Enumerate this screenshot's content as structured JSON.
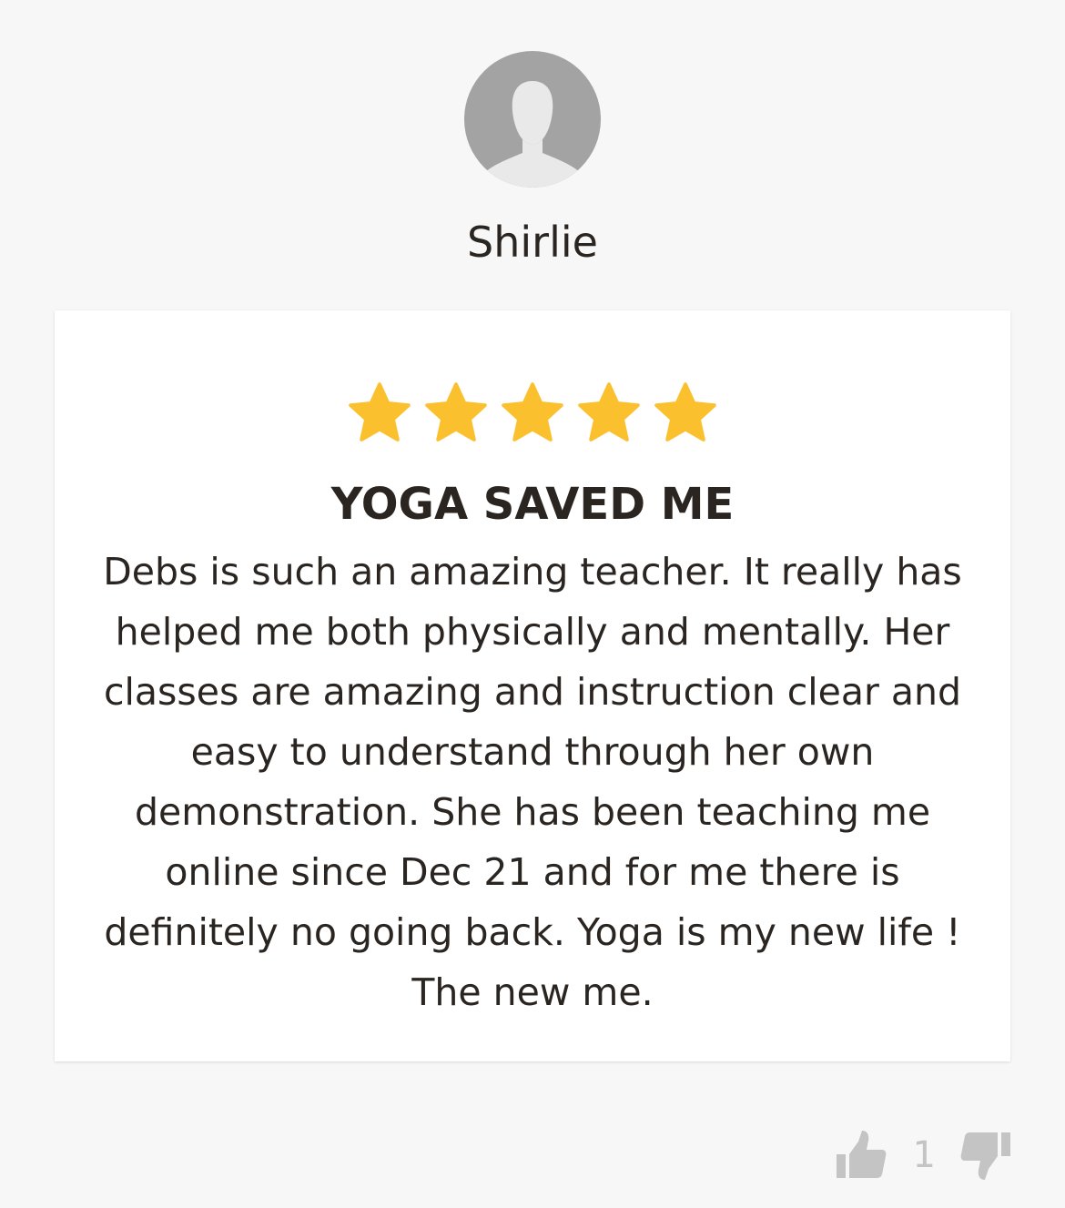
{
  "reviewer": {
    "name": "Shirlie",
    "avatar_icon": "default-user-avatar-icon"
  },
  "review": {
    "rating": 5,
    "rating_max": 5,
    "star_color": "#fbc02d",
    "title": "YOGA SAVED ME",
    "body": "Debs is such an amazing teacher. It really has helped me both physically and mentally. Her classes are amazing and instruction clear and easy to understand through her own demonstration. She has been teaching me online since Dec 21 and for me there is definitely no going back. Yoga is my new life ! The new me."
  },
  "votes": {
    "helpful_count": "1",
    "thumbs_up_icon": "thumbs-up-icon",
    "thumbs_down_icon": "thumbs-down-icon",
    "icon_color": "#c4c4c4"
  }
}
